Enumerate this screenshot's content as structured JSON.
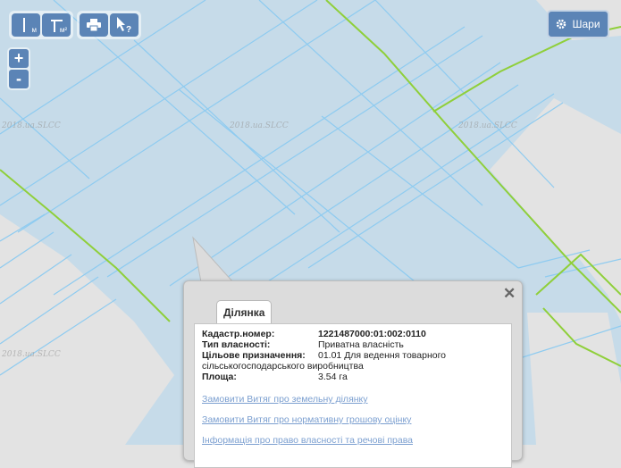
{
  "toolbar": {
    "measure_length_sub": "м",
    "measure_area_sub": "м²"
  },
  "zoom": {
    "in_label": "+",
    "out_label": "-"
  },
  "layers_button": {
    "label": "Шари"
  },
  "watermark": "2018.ua.SLCC",
  "popup": {
    "tab_label": "Ділянка",
    "fields": [
      {
        "label": "Кадастр.номер:",
        "value": "1221487000:01:002:0110",
        "bold": true
      },
      {
        "label": "Тип власності:",
        "value": "Приватна власність"
      },
      {
        "label": "Цільове призначення:",
        "value": "01.01 Для ведення товарного",
        "value2": "сільськогосподарського виробництва"
      },
      {
        "label": "Площа:",
        "value": "3.54 га"
      }
    ],
    "links": [
      "Замовити Витяг про земельну ділянку",
      "Замовити Витяг про нормативну грошову оцінку",
      "Інформація про право власності та речові права"
    ]
  },
  "colors": {
    "parcel_fill": "#c6dbe9",
    "parcel_border": "#8ecbf0",
    "road_line": "#8fcf3a",
    "background": "#e3e3e3",
    "button": "#5b84b6"
  }
}
